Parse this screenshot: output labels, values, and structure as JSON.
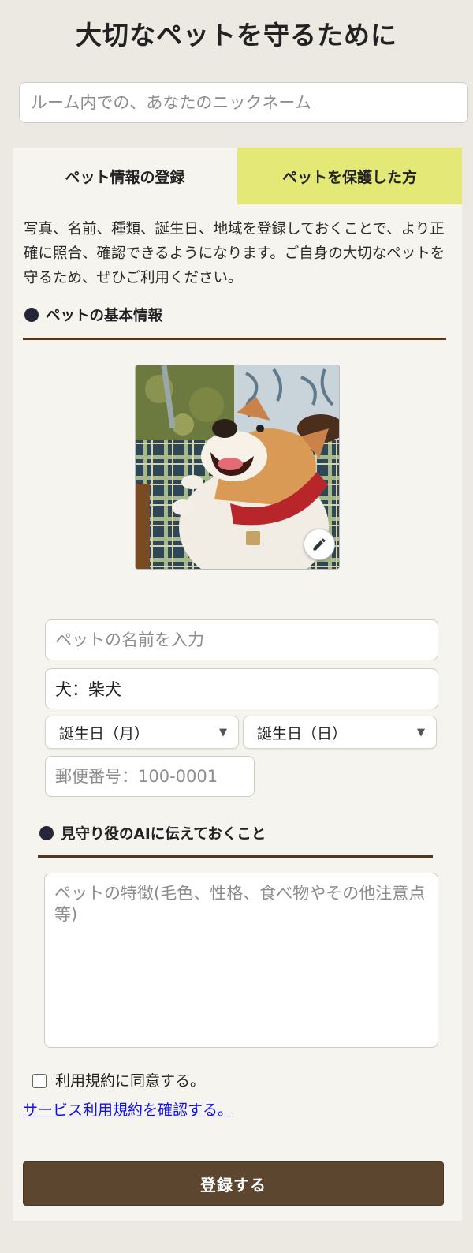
{
  "header": {
    "title": "大切なペットを守るために"
  },
  "nickname": {
    "placeholder": "ルーム内での、あなたのニックネーム"
  },
  "tabs": [
    {
      "label": "ペット情報の登録",
      "active": true
    },
    {
      "label": "ペットを保護した方",
      "active": false
    }
  ],
  "description": "写真、名前、種類、誕生日、地域を登録しておくことで、より正確に照合、確認できるようになります。ご自身の大切なペットを守るため、ぜひご利用ください。",
  "basic_info": {
    "heading": "ペットの基本情報",
    "photo_icon": "dog-photo",
    "edit_icon": "pencil-icon",
    "name_placeholder": "ペットの名前を入力",
    "species_value": "犬：柴犬",
    "birth_month": "誕生日（月）",
    "birth_day": "誕生日（日）",
    "postal_placeholder": "郵便番号：100-0001"
  },
  "ai_notes": {
    "heading": "見守り役のAIに伝えておくこと",
    "placeholder": "ペットの特徴(毛色、性格、食べ物やその他注意点等)"
  },
  "terms": {
    "checkbox_label": "利用規約に同意する。",
    "link_text": "サービス利用規約を確認する。"
  },
  "submit_label": "登録する",
  "colors": {
    "page_bg": "#ebe9e1",
    "card_bg": "#f6f4ee",
    "inactive_tab": "#e3e876",
    "rule": "#5a3516",
    "button": "#5c4630",
    "link": "#1010ee"
  }
}
